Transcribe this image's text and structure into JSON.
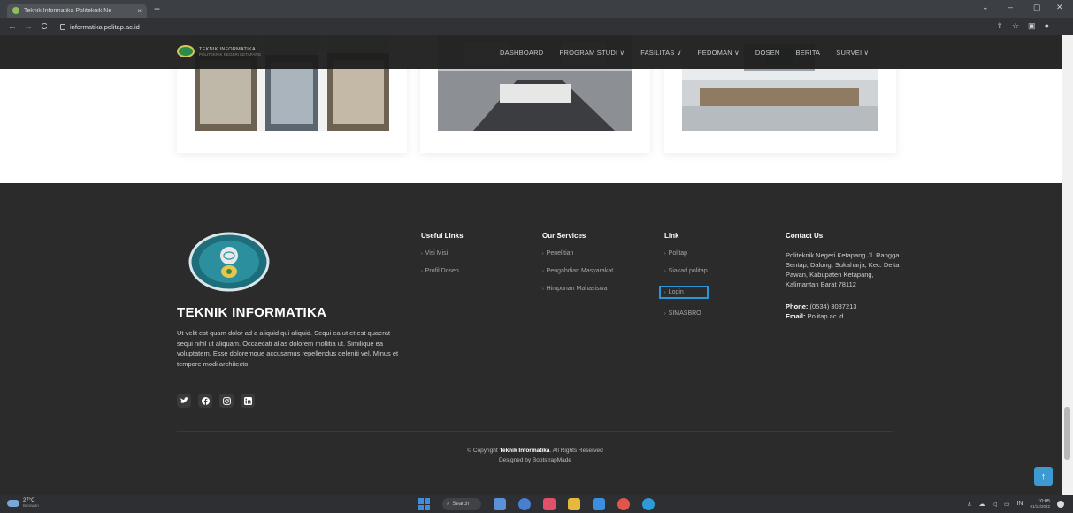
{
  "browser": {
    "tab_title": "Teknik Informatika Politeknik Ne",
    "tab_close": "×",
    "new_tab": "+",
    "url": "informatika.politap.ac.id",
    "window_controls": [
      "⌄",
      "–",
      "▢",
      "✕"
    ],
    "nav_buttons": [
      "←",
      "→",
      "C"
    ]
  },
  "header": {
    "logo_line1": "TEKNIK INFORMATIKA",
    "logo_line2": "POLITEKNIK NEGERI KETAPANG",
    "nav": [
      {
        "label": "DASHBOARD"
      },
      {
        "label": "PROGRAM STUDI ∨"
      },
      {
        "label": "FASILITAS ∨"
      },
      {
        "label": "PEDOMAN ∨"
      },
      {
        "label": "DOSEN"
      },
      {
        "label": "BERITA"
      },
      {
        "label": "SURVEI ∨"
      }
    ]
  },
  "footer": {
    "brand": "TEKNIK INFORMATIKA",
    "about": "Ut velit est quam dolor ad a aliquid qui aliquid. Sequi ea ut et est quaerat sequi nihil ut aliquam. Occaecati alias dolorem mollitia ut. Similique ea voluptatem. Esse doloremque accusamus repellendus deleniti vel. Minus et tempore modi architecto.",
    "useful_links": {
      "title": "Useful Links",
      "items": [
        "Visi Misi",
        "Profil Dosen"
      ]
    },
    "services": {
      "title": "Our Services",
      "items": [
        "Penelitian",
        "Pengabdian Masyarakat",
        "Himpunan Mahasiswa"
      ]
    },
    "link": {
      "title": "Link",
      "items": [
        "Politap",
        "Siakad politap",
        "Login",
        "SIMASBRO"
      ]
    },
    "contact": {
      "title": "Contact Us",
      "address": "Politeknik Negeri Ketapang Jl. Rangga Sentap, Dalong, Sukaharja, Kec. Delta Pawan, Kabupaten Ketapang, Kalimantan Barat 78112",
      "phone_label": "Phone:",
      "phone": "(0534) 3037213",
      "email_label": "Email:",
      "email": "Politap.ac.id"
    },
    "copyright_prefix": "© Copyright",
    "copyright_brand": "Teknik Informatika",
    "copyright_suffix": ". All Rights Reserved",
    "designed_by": "Designed by BootstrapMade",
    "back_to_top": "↑"
  },
  "taskbar": {
    "temp": "27°C",
    "weather": "Berawan",
    "search": "Search",
    "time": "10:05",
    "date": "01/12/2022",
    "lang": "IN"
  }
}
